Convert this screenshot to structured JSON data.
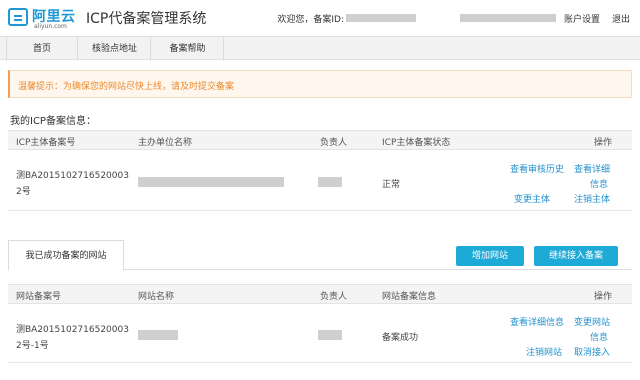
{
  "header": {
    "logo_cn": "阿里云",
    "logo_en": "aliyun.com",
    "system_title": "ICP代备案管理系统",
    "welcome": "欢迎您，备案ID:",
    "account_settings": "账户设置",
    "logout": "退出"
  },
  "nav": {
    "items": [
      {
        "label": "首页"
      },
      {
        "label": "核验点地址"
      },
      {
        "label": "备案帮助"
      }
    ]
  },
  "tip": {
    "text": "温馨提示：为确保您的网站尽快上线，请及时提交备案"
  },
  "icp_section": {
    "title": "我的ICP备案信息：",
    "headers": [
      "ICP主体备案号",
      "主办单位名称",
      "负责人",
      "ICP主体备案状态",
      "操作"
    ],
    "row": {
      "icp_no_line1": "测BA2015102716520003",
      "icp_no_line2": "2号",
      "status": "正常",
      "actions": [
        "查看审核历史",
        "查看详细",
        "信息",
        "变更主体",
        "注销主体"
      ]
    }
  },
  "site_section": {
    "tab_label": "我已成功备案的网站",
    "add_button": "增加网站",
    "continue_button": "继续接入备案",
    "headers": [
      "网站备案号",
      "网站名称",
      "负责人",
      "网站备案信息",
      "操作"
    ],
    "row": {
      "site_no_line1": "测BA2015102716520003",
      "site_no_line2": "2号-1号",
      "info": "备案成功",
      "actions": [
        "查看详细信息",
        "变更网站",
        "信息",
        "注销网站",
        "取消接入"
      ]
    }
  },
  "colors": {
    "brand": "#1f99d6",
    "button": "#1eaad7",
    "link": "#2291d0",
    "tip_text": "#ec8a2d"
  }
}
